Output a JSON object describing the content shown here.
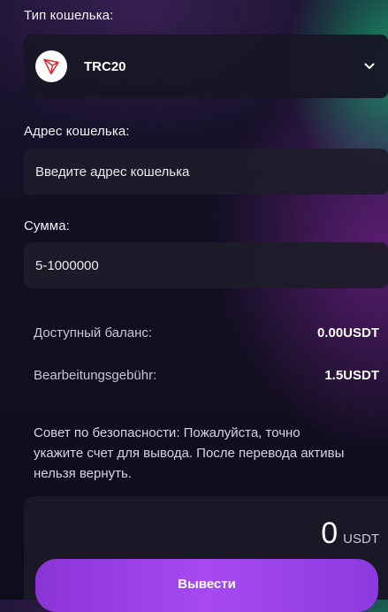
{
  "wallet_type": {
    "label": "Тип кошелька:",
    "selected_network": "TRC20",
    "network_icon": "tron-logo-icon",
    "dropdown_icon": "chevron-down-icon",
    "accent_color": "#e5242a"
  },
  "wallet_address": {
    "label": "Адрес кошелька:",
    "value": "",
    "placeholder": "Введите адрес кошелька"
  },
  "amount": {
    "label": "Сумма:",
    "value": "",
    "placeholder": "5-1000000"
  },
  "info": {
    "balance_label": "Доступный баланс:",
    "balance_value": "0.00USDT",
    "fee_label": "Bearbeitungsgebühr:",
    "fee_value": "1.5USDT"
  },
  "security_advice": "Совет по безопасности: Пожалуйста, точно укажите счет для вывода. После перевода активы нельзя вернуть.",
  "total": {
    "amount": "0",
    "currency": "USDT"
  },
  "withdraw_button": {
    "label": "Вывести",
    "color": "#9b44e6"
  }
}
